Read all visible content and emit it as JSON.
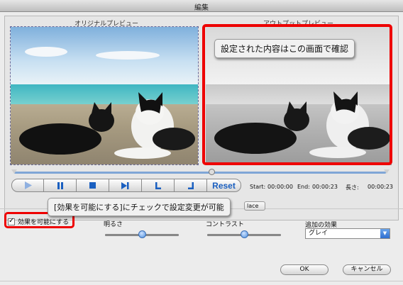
{
  "window": {
    "title": "編集"
  },
  "preview": {
    "original_label": "オリジナルプレビュー",
    "output_label": "アウトプットプレビュー"
  },
  "annotations": {
    "output_callout": "設定された内容はこの画面で確認",
    "effect_callout": "[効果を可能にする]にチェックで設定変更が可能",
    "highlight_color": "#e00000"
  },
  "transport": {
    "play_icon": "play-icon",
    "pause_icon": "pause-icon",
    "stop_icon": "stop-icon",
    "next_frame_icon": "step-forward-icon",
    "mark_start_icon": "mark-in-icon",
    "mark_end_icon": "mark-out-icon",
    "reset_label": "Reset"
  },
  "times": {
    "start_label": "Start:",
    "start_value": "00:00:00",
    "end_label": "End:",
    "end_value": "00:00:23",
    "length_label": "長さ:",
    "length_value": "00:00:23"
  },
  "settings": {
    "replace_tab_label": "lace",
    "enable_effects_label": "効果を可能にする",
    "enable_effects_checked": true,
    "brightness_label": "明るさ",
    "brightness_value": 0.5,
    "contrast_label": "コントラスト",
    "contrast_value": 0.5,
    "extra_effect_label": "追加の効果",
    "extra_effect_value": "グレイ"
  },
  "buttons": {
    "ok_label": "OK",
    "cancel_label": "キャンセル"
  }
}
